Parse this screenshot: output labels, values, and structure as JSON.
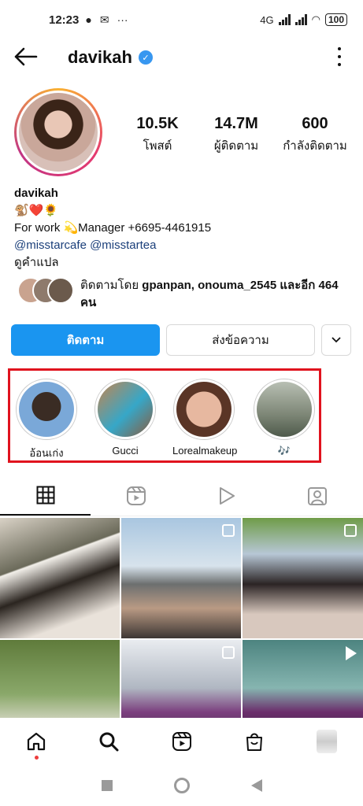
{
  "status_bar": {
    "time": "12:23",
    "battery": "100",
    "network": "4G"
  },
  "header": {
    "username": "davikah",
    "verified": true
  },
  "profile": {
    "stats": [
      {
        "value": "10.5K",
        "label": "โพสต์"
      },
      {
        "value": "14.7M",
        "label": "ผู้ติดตาม"
      },
      {
        "value": "600",
        "label": "กำลังติดตาม"
      }
    ],
    "display_name": "davikah",
    "emoji_line": "🐒❤️🌻",
    "bio_line": "For work 💫Manager  +6695-4461915",
    "mentions": "@misstarcafe @misstartea",
    "translate": "ดูคำแปล",
    "followed_by_prefix": "ติดตามโดย ",
    "followed_by_names": "gpanpan, onouma_2545",
    "followed_by_suffix": " และอีก 464 คน"
  },
  "actions": {
    "follow_label": "ติดตาม",
    "message_label": "ส่งข้อความ"
  },
  "highlights": [
    {
      "label": "อ้อนเก่ง"
    },
    {
      "label": "Gucci"
    },
    {
      "label": "Lorealmakeup"
    },
    {
      "label": "🎶"
    }
  ],
  "tabs": [
    "grid-icon",
    "reels-icon",
    "video-icon",
    "tagged-icon"
  ],
  "bottom_nav": [
    "home-icon",
    "search-icon",
    "reels-icon",
    "shop-icon",
    "profile-avatar"
  ],
  "colors": {
    "primary_button": "#1a95f0",
    "highlight_box": "#e0131e",
    "verified": "#3897f0"
  }
}
